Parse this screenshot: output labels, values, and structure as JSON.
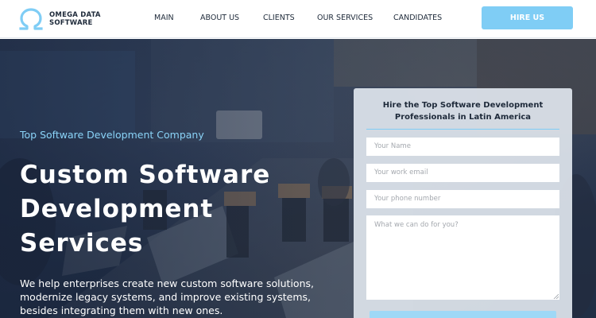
{
  "brand": {
    "line1": "OMEGA DATA",
    "line2": "SOFTWARE",
    "icon": "omega-logo"
  },
  "nav": {
    "items": [
      "MAIN",
      "ABOUT US",
      "CLIENTS",
      "OUR SERVICES",
      "CANDIDATES"
    ],
    "cta": "HIRE US"
  },
  "hero": {
    "kicker": "Top Software Development Company",
    "headline": [
      "Custom Software",
      "Development",
      "Services"
    ],
    "lead": "We help enterprises create new custom software solutions, modernize legacy systems, and improve existing systems, besides integrating them with new ones."
  },
  "form": {
    "title_line1": "Hire the Top Software Development",
    "title_line2": "Professionals in Latin America",
    "name_placeholder": "Your Name",
    "email_placeholder": "Your work email",
    "phone_placeholder": "Your phone number",
    "message_placeholder": "What we can do for you?"
  },
  "colors": {
    "accent": "#7fcdf5",
    "heading": "#1e2a3a",
    "kicker": "#8ad3f7"
  }
}
